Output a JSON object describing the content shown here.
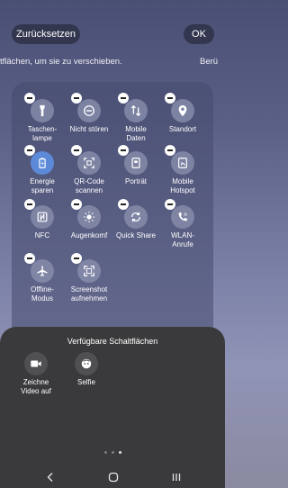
{
  "header": {
    "reset_label": "Zurücksetzen",
    "ok_label": "OK"
  },
  "hint": {
    "text": "tflächen, um sie zu verschieben.",
    "next_text": "Berü"
  },
  "active_tiles": [
    {
      "label": "Taschen-\nlampe",
      "icon": "flashlight-icon"
    },
    {
      "label": "Nicht stören",
      "icon": "do-not-disturb-icon"
    },
    {
      "label": "Mobile\nDaten",
      "icon": "mobile-data-icon"
    },
    {
      "label": "Standort",
      "icon": "location-icon"
    },
    {
      "label": "Energie\nsparen",
      "icon": "battery-icon"
    },
    {
      "label": "QR-Code\nscannen",
      "icon": "qr-code-icon"
    },
    {
      "label": "Porträt",
      "icon": "portrait-icon"
    },
    {
      "label": "Mobile\nHotspot",
      "icon": "hotspot-icon"
    },
    {
      "label": "NFC",
      "icon": "nfc-icon"
    },
    {
      "label": "Augenkomf",
      "icon": "eye-comfort-icon"
    },
    {
      "label": "Quick Share",
      "icon": "quick-share-icon"
    },
    {
      "label": "WLAN-\nAnrufe",
      "icon": "wifi-calling-icon"
    },
    {
      "label": "Offline-\nModus",
      "icon": "airplane-icon"
    },
    {
      "label": "Screenshot\naufnehmen",
      "icon": "screenshot-icon"
    }
  ],
  "available": {
    "title": "Verfügbare Schaltflächen",
    "tiles": [
      {
        "label": "Zeichne\nVideo auf",
        "icon": "video-camera-icon"
      },
      {
        "label": "Selfie",
        "icon": "selfie-icon"
      }
    ]
  },
  "pager": {
    "pages": 3,
    "current": 3
  },
  "colors": {
    "battery_tile": "#5c8ad8",
    "sheet_bg": "#3a3a3c"
  }
}
